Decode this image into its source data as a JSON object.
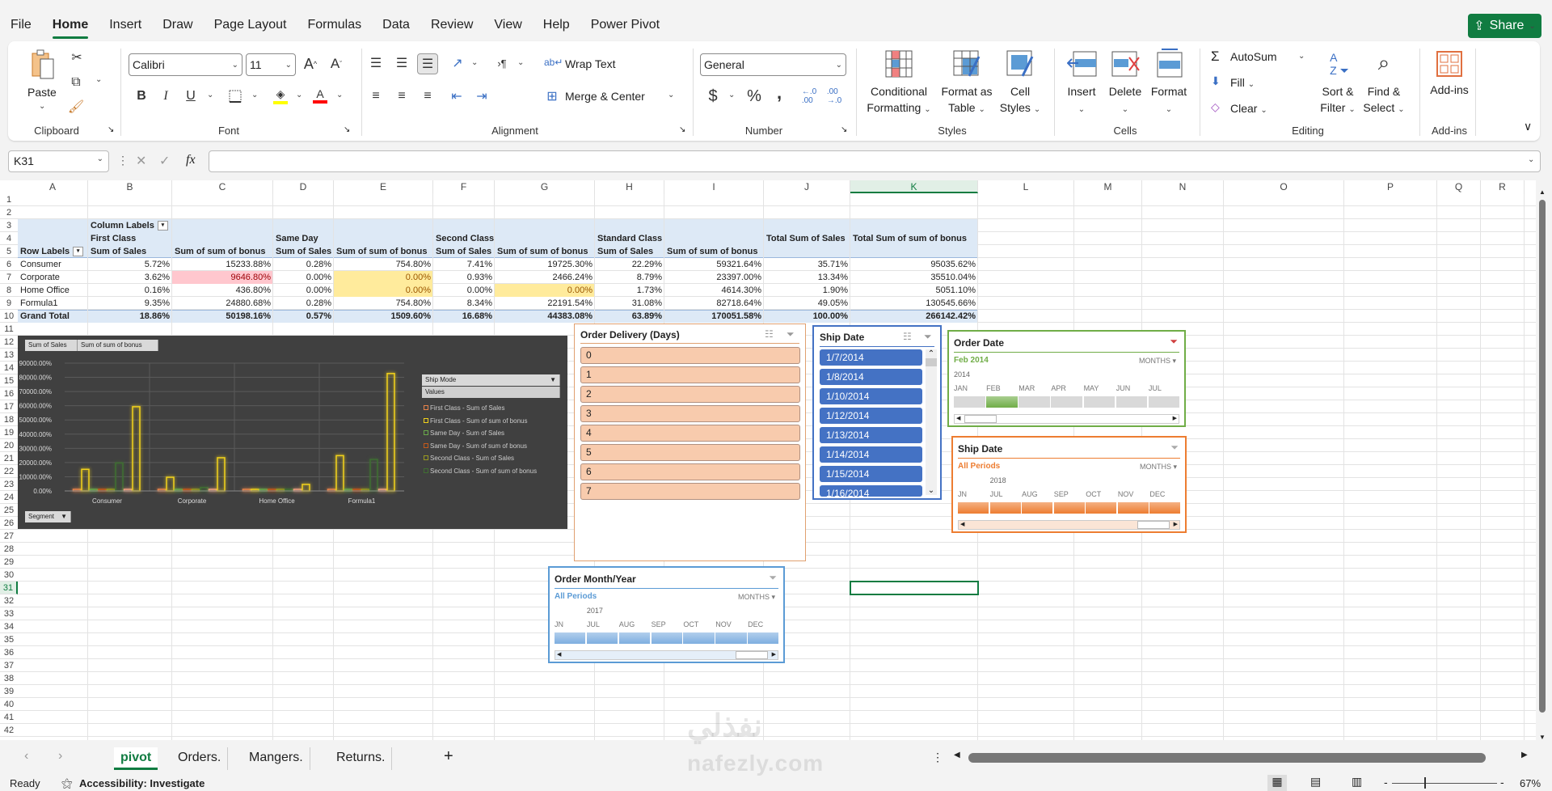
{
  "menu": {
    "tabs": [
      "File",
      "Home",
      "Insert",
      "Draw",
      "Page Layout",
      "Formulas",
      "Data",
      "Review",
      "View",
      "Help",
      "Power Pivot"
    ],
    "active": "Home",
    "share": "Share"
  },
  "ribbon": {
    "clipboard": {
      "paste": "Paste",
      "label": "Clipboard"
    },
    "font": {
      "name": "Calibri",
      "size": "11",
      "label": "Font",
      "bold": "B",
      "italic": "I",
      "underline": "U",
      "highlight_color": "#ffff00",
      "font_color": "#ff0000"
    },
    "alignment": {
      "wrap_text": "Wrap Text",
      "merge_center": "Merge & Center",
      "label": "Alignment"
    },
    "number": {
      "format": "General",
      "currency": "$",
      "percent": "%",
      "comma": ",",
      "label": "Number"
    },
    "styles": {
      "conditional": [
        "Conditional",
        "Formatting"
      ],
      "format_table": [
        "Format as",
        "Table"
      ],
      "cell_styles": [
        "Cell",
        "Styles"
      ],
      "label": "Styles"
    },
    "cells": {
      "insert": "Insert",
      "delete": "Delete",
      "format": "Format",
      "label": "Cells"
    },
    "editing": {
      "autosum": "AutoSum",
      "fill": "Fill",
      "clear": "Clear",
      "sort": [
        "Sort &",
        "Filter"
      ],
      "find": [
        "Find &",
        "Select"
      ],
      "label": "Editing"
    },
    "addins": {
      "button": "Add-ins",
      "label": "Add-ins"
    }
  },
  "formula_bar": {
    "name_box": "K31",
    "fx": "fx",
    "value": ""
  },
  "sheet": {
    "columns": [
      "A",
      "B",
      "C",
      "D",
      "E",
      "F",
      "G",
      "H",
      "I",
      "J",
      "K",
      "L",
      "M",
      "N",
      "O",
      "P",
      "Q",
      "R"
    ],
    "selected_column": "K",
    "rows": [
      1,
      2,
      3,
      4,
      5,
      6,
      7,
      8,
      9,
      10,
      11,
      12,
      13,
      14,
      15,
      16,
      17,
      18,
      19,
      20,
      21,
      22,
      23,
      24,
      25,
      26,
      27,
      28,
      29,
      30,
      31,
      32,
      33,
      34,
      35,
      36,
      37,
      38,
      39,
      40,
      41,
      42
    ],
    "selected_row": 31
  },
  "pivot": {
    "column_labels": "Column Labels",
    "row_labels": "Row Labels",
    "ship_modes": [
      "First Class",
      "Same Day",
      "Second Class",
      "Standard Class"
    ],
    "sum_sales": "Sum of Sales",
    "sum_bonus": "Sum of sum of bonus",
    "total_sales": "Total Sum of Sales",
    "total_bonus": "Total Sum of sum of bonus",
    "rows": [
      {
        "label": "Consumer",
        "values": [
          "5.72%",
          "15233.88%",
          "0.28%",
          "754.80%",
          "7.41%",
          "19725.30%",
          "22.29%",
          "59321.64%",
          "35.71%",
          "95035.62%"
        ]
      },
      {
        "label": "Corporate",
        "values": [
          "3.62%",
          "9646.80%",
          "0.00%",
          "0.00%",
          "0.93%",
          "2466.24%",
          "8.79%",
          "23397.00%",
          "13.34%",
          "35510.04%"
        ]
      },
      {
        "label": "Home Office",
        "values": [
          "0.16%",
          "436.80%",
          "0.00%",
          "0.00%",
          "0.00%",
          "0.00%",
          "1.73%",
          "4614.30%",
          "1.90%",
          "5051.10%"
        ]
      },
      {
        "label": "Formula1",
        "values": [
          "9.35%",
          "24880.68%",
          "0.28%",
          "754.80%",
          "8.34%",
          "22191.54%",
          "31.08%",
          "82718.64%",
          "49.05%",
          "130545.66%"
        ]
      }
    ],
    "grand_total": {
      "label": "Grand Total",
      "values": [
        "18.86%",
        "50198.16%",
        "0.57%",
        "1509.60%",
        "16.68%",
        "44383.08%",
        "63.89%",
        "170051.58%",
        "100.00%",
        "266142.42%"
      ]
    },
    "highlights": {
      "red_fill": "#ffc7ce",
      "red_text": "#9c0006",
      "yellow_fill": "#ffeb9c",
      "yellow_text": "#9c5700",
      "header_fill": "#dde9f6"
    }
  },
  "chart_data": {
    "type": "bar",
    "field_buttons": [
      "Sum of Sales",
      "Sum of sum of bonus"
    ],
    "axis_field": "Segment",
    "legend_field": "Ship Mode",
    "legend_values": "Values",
    "legend_placement": "right",
    "categories": [
      "Consumer",
      "Corporate",
      "Home Office",
      "Formula1"
    ],
    "ylim": [
      0,
      90000
    ],
    "yticks": [
      "0.00%",
      "10000.00%",
      "20000.00%",
      "30000.00%",
      "40000.00%",
      "50000.00%",
      "60000.00%",
      "70000.00%",
      "80000.00%",
      "90000.00%"
    ],
    "grid": true,
    "series": [
      {
        "name": "First Class - Sum of Sales",
        "values": [
          5.72,
          3.62,
          0.16,
          9.35
        ],
        "color": "#e8834a"
      },
      {
        "name": "First Class - Sum of sum of bonus",
        "values": [
          15233.88,
          9646.8,
          436.8,
          24880.68
        ],
        "color": "#f2d21b"
      },
      {
        "name": "Same Day - Sum of Sales",
        "values": [
          0.28,
          0,
          0,
          0.28
        ],
        "color": "#6aaa4a"
      },
      {
        "name": "Same Day - Sum of sum of bonus",
        "values": [
          754.8,
          0,
          0,
          754.8
        ],
        "color": "#c5591a"
      },
      {
        "name": "Second Class - Sum of Sales",
        "values": [
          7.41,
          0.93,
          0,
          8.34
        ],
        "color": "#9a9a20"
      },
      {
        "name": "Second Class - Sum of sum of bonus",
        "values": [
          19725.3,
          2466.24,
          0,
          22191.54
        ],
        "color": "#3f6e32"
      },
      {
        "values": [
          22.29,
          8.79,
          1.73,
          31.08
        ],
        "color": "#f0a080"
      },
      {
        "values": [
          59321.64,
          23397.0,
          4614.3,
          82718.64
        ],
        "color": "#f2d21b"
      }
    ]
  },
  "slicers": {
    "order_delivery": {
      "title": "Order Delivery (Days)",
      "items": [
        "0",
        "1",
        "2",
        "3",
        "4",
        "5",
        "6",
        "7"
      ],
      "border": "#e0a070"
    },
    "ship_date": {
      "title": "Ship Date",
      "items": [
        "1/7/2014",
        "1/8/2014",
        "1/10/2014",
        "1/12/2014",
        "1/13/2014",
        "1/14/2014",
        "1/15/2014",
        "1/16/2014"
      ],
      "border": "#4472c4"
    }
  },
  "timelines": [
    {
      "id": "order-date",
      "title": "Order Date",
      "selection": "Feb 2014",
      "level": "MONTHS",
      "year": "2014",
      "months": [
        "JAN",
        "FEB",
        "MAR",
        "APR",
        "MAY",
        "JUN",
        "JUL"
      ],
      "selected": [
        1
      ],
      "accent": "#70ad47",
      "fill": "#70ad47",
      "empty": "#d9d9d9"
    },
    {
      "id": "ship-date",
      "title": "Ship Date",
      "selection": "All Periods",
      "level": "MONTHS",
      "year": "2018",
      "months": [
        "JN",
        "JUL",
        "AUG",
        "SEP",
        "OCT",
        "NOV",
        "DEC"
      ],
      "selected": [
        0,
        1,
        2,
        3,
        4,
        5,
        6
      ],
      "accent": "#ed7d31",
      "fill": "#ed7d31",
      "empty": "#d9d9d9"
    },
    {
      "id": "order-month-year",
      "title": "Order Month/Year",
      "selection": "All Periods",
      "level": "MONTHS",
      "year": "2017",
      "months": [
        "JN",
        "JUL",
        "AUG",
        "SEP",
        "OCT",
        "NOV",
        "DEC"
      ],
      "selected": [
        0,
        1,
        2,
        3,
        4,
        5,
        6
      ],
      "accent": "#5b9bd5",
      "fill": "#7eaee0",
      "empty": "#d9d9d9"
    }
  ],
  "sheet_tabs": {
    "tabs": [
      "pivot",
      "Orders.",
      "Mangers.",
      "Returns."
    ],
    "active": "pivot",
    "add": "+"
  },
  "status_bar": {
    "ready": "Ready",
    "accessibility": "Accessibility: Investigate",
    "zoom": "67%"
  },
  "watermark": "nafezly.com"
}
